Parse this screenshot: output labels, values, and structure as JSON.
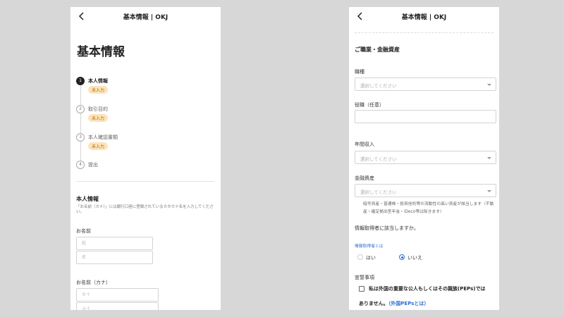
{
  "header": {
    "title": "基本情報 | OKJ"
  },
  "left": {
    "page_title": "基本情報",
    "steps": [
      {
        "num": "1",
        "label": "本人情報",
        "badge": "未入力"
      },
      {
        "num": "2",
        "label": "取引目的",
        "badge": "未入力"
      },
      {
        "num": "3",
        "label": "本人確認書類",
        "badge": "未入力"
      },
      {
        "num": "4",
        "label": "提出"
      }
    ],
    "section": {
      "title": "本人情報",
      "note": "「お名前（カナ）」には銀行口座に登録されているカタカナ名を入力してください。"
    },
    "name": {
      "label": "お名前",
      "last_placeholder": "姓",
      "first_placeholder": "名"
    },
    "kana": {
      "label": "お名前（カナ）",
      "last_placeholder": "セイ",
      "first_placeholder": "メイ"
    }
  },
  "right": {
    "section_title": "ご職業・金融資産",
    "occupation": {
      "label": "職種",
      "placeholder": "選択してください"
    },
    "position": {
      "label": "役職（任意）"
    },
    "income": {
      "label": "年間収入",
      "placeholder": "選択してください"
    },
    "assets": {
      "label": "金融資産",
      "placeholder": "選択してください",
      "note": "暗号資産・普通株・投資信託等の流動性の高い資産が該当します（不動産・確定拠出型年金・iDeco等は除きます）"
    },
    "pep_question": {
      "text": "情報取得者に該当しますか。",
      "link": "情報取得者とは",
      "options": [
        {
          "label": "はい",
          "checked": false
        },
        {
          "label": "いいえ",
          "checked": true
        }
      ]
    },
    "declaration": {
      "title": "宣誓事項",
      "line1": "私は外国の重要な公人もしくはその親族(PEPs)では",
      "line2": "ありません。",
      "link": "（外国PEPsとは）",
      "checked": false
    }
  },
  "colors": {
    "accent": "#2a6fd6",
    "badge_bg": "#fde3b8",
    "badge_text": "#a8681a"
  }
}
